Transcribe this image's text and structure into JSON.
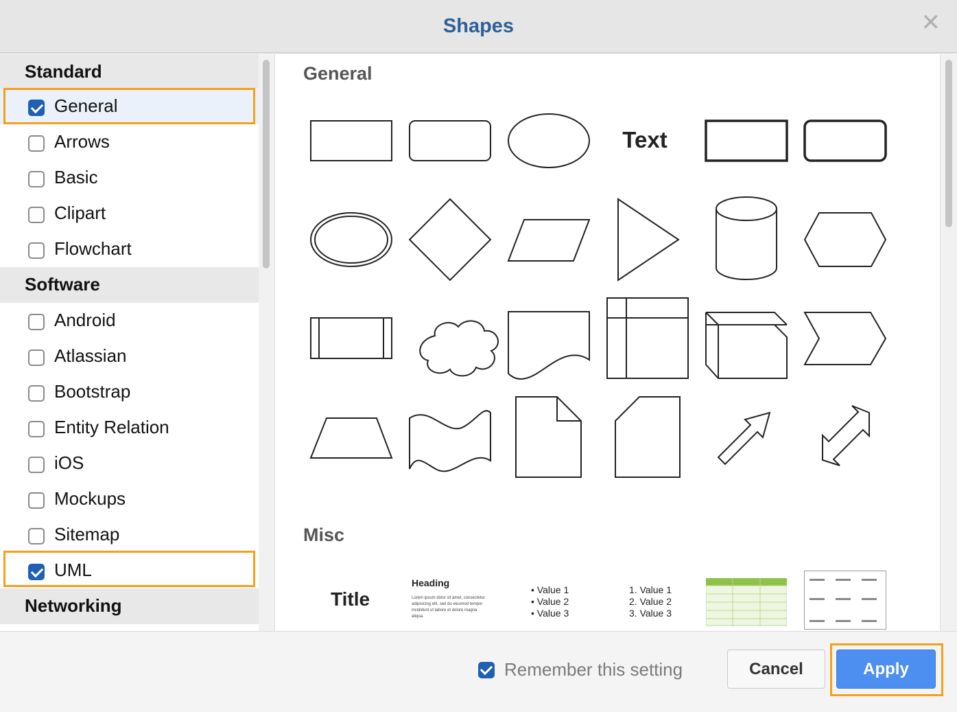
{
  "dialog": {
    "title": "Shapes",
    "close_icon": "close-icon"
  },
  "sidebar": {
    "groups": [
      {
        "header": "Standard",
        "items": [
          {
            "label": "General",
            "checked": true
          },
          {
            "label": "Arrows",
            "checked": false
          },
          {
            "label": "Basic",
            "checked": false
          },
          {
            "label": "Clipart",
            "checked": false
          },
          {
            "label": "Flowchart",
            "checked": false
          }
        ]
      },
      {
        "header": "Software",
        "items": [
          {
            "label": "Android",
            "checked": false
          },
          {
            "label": "Atlassian",
            "checked": false
          },
          {
            "label": "Bootstrap",
            "checked": false
          },
          {
            "label": "Entity Relation",
            "checked": false
          },
          {
            "label": "iOS",
            "checked": false
          },
          {
            "label": "Mockups",
            "checked": false
          },
          {
            "label": "Sitemap",
            "checked": false
          },
          {
            "label": "UML",
            "checked": true
          }
        ]
      },
      {
        "header": "Networking",
        "items": []
      }
    ]
  },
  "main": {
    "sections": [
      {
        "title": "General"
      },
      {
        "title": "Misc"
      }
    ],
    "text_shape_label": "Text",
    "misc": {
      "title_label": "Title",
      "heading_label": "Heading",
      "lorem": "Lorem ipsum dolor sit amet, consectetur adipisicing elit, sed do eiusmod tempor incididunt ut labore et dolore magna aliqua.",
      "bullets": [
        "Value 1",
        "Value 2",
        "Value 3"
      ],
      "numbered": [
        "1.  Value 1",
        "2.  Value 2",
        "3.  Value 3"
      ]
    }
  },
  "footer": {
    "remember_label": "Remember this setting",
    "remember_checked": true,
    "cancel_label": "Cancel",
    "apply_label": "Apply"
  },
  "colors": {
    "accent": "#2f5f97",
    "highlight": "#f5a01a",
    "apply": "#4d8ff0",
    "checkbox": "#1f5fb4"
  }
}
